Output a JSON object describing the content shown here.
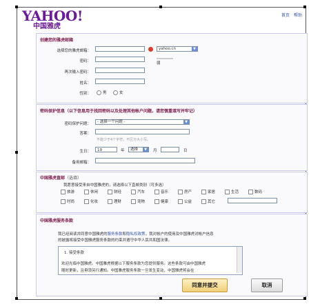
{
  "brand": {
    "logo_main": "YAHOO!",
    "logo_sub": "中国雅虎"
  },
  "toplinks": [
    "首页",
    "帮助"
  ],
  "section1": {
    "title": "创建您的雅虎邮箱",
    "email_label": "选择您的雅虎邮箱：",
    "email_value": "",
    "domain": "yahoo.cn",
    "password_label": "密码：",
    "strength_label": "弱",
    "confirm_label": "再次输入密码：",
    "name_label": "姓名：",
    "gender_label": "性别：",
    "gender_male": "男",
    "gender_female": "女"
  },
  "section2": {
    "title": "密码保护信息（以下信息用于找回密码以及处理其他帐户问题，请您慎重填写并牢记）",
    "question_label": "密码保护问题：",
    "question_value": "- 选择一个问题 -",
    "answer_label": "答案：",
    "answer_hint": "不能少于4个字符，不区分大小写。",
    "birthday_label": "生日：",
    "year_value": "19",
    "year_unit": "年",
    "month_value": "选择",
    "month_unit": "月",
    "day_unit": "日",
    "backup_email_label": "备用邮箱："
  },
  "section3": {
    "title": "中国雅虎直邮",
    "title_note": "（选填）",
    "prompt": "我愿意接受来自中国雅虎的，请选择以下直邮类别（可多选）",
    "row1": [
      "旅游",
      "休闲",
      "财经",
      "汽车",
      "音乐",
      "房产",
      "家居",
      "生活",
      "数码"
    ],
    "row2": [
      "时尚",
      "化妆",
      "理财",
      "宠物",
      "健康",
      "公益",
      "其它"
    ]
  },
  "section4": {
    "title": "中国雅虎服务条款",
    "intro_pre": "我已经阅读并同意中国雅虎的",
    "link1": "服务条款",
    "intro_and": "和",
    "link2": "隐私权政策",
    "intro_post": "，我对帐户的使用及中国雅虎对帐户信息",
    "intro_line2": "的披露将接受中国雅虎服务条款的约束并遵守中华人民共和国法律。",
    "terms_heading": "1. 接受条款",
    "terms_body1": "欢迎光临中国雅虎。中国雅虎根据以下服务条款为您提供服务。这些条款可由中国雅虎",
    "terms_body2": "随时更新，且毋须另行通知。中国雅虎服务条款一旦发生变动，中国雅虎将会在"
  },
  "buttons": {
    "submit": "同意并提交",
    "cancel": "取消"
  },
  "colors": {
    "brand_purple": "#6a1a9a",
    "section_title": "#7a1a4a",
    "link_blue": "#3355aa",
    "panel_border": "#c9c9e9"
  }
}
